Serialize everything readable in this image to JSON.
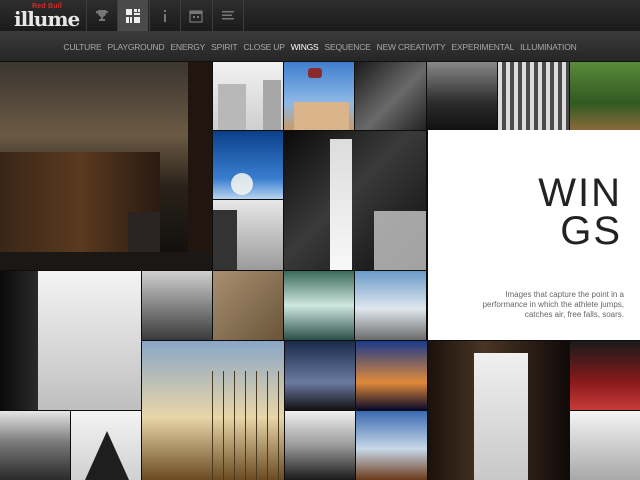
{
  "logo": {
    "brand": "Red Bull",
    "name": "illume"
  },
  "toolbar": {
    "icons": [
      "trophy-icon",
      "grid-icon",
      "info-icon",
      "calendar-icon",
      "list-icon"
    ],
    "active": "grid-icon"
  },
  "categories": [
    "Culture",
    "Playground",
    "Energy",
    "Spirit",
    "Close Up",
    "Wings",
    "Sequence",
    "New Creativity",
    "Experimental",
    "Illumination"
  ],
  "active_category": "Wings",
  "section": {
    "title_line1": "WIN",
    "title_line2": "GS",
    "description": "Images that capture the point in a performance in which the athlete jumps, catches air, free falls, soars."
  },
  "colors": {
    "background": "#0d0d0d",
    "active_text": "#ffffff",
    "inactive_text": "#a8a8a8",
    "panel": "#ffffff"
  }
}
